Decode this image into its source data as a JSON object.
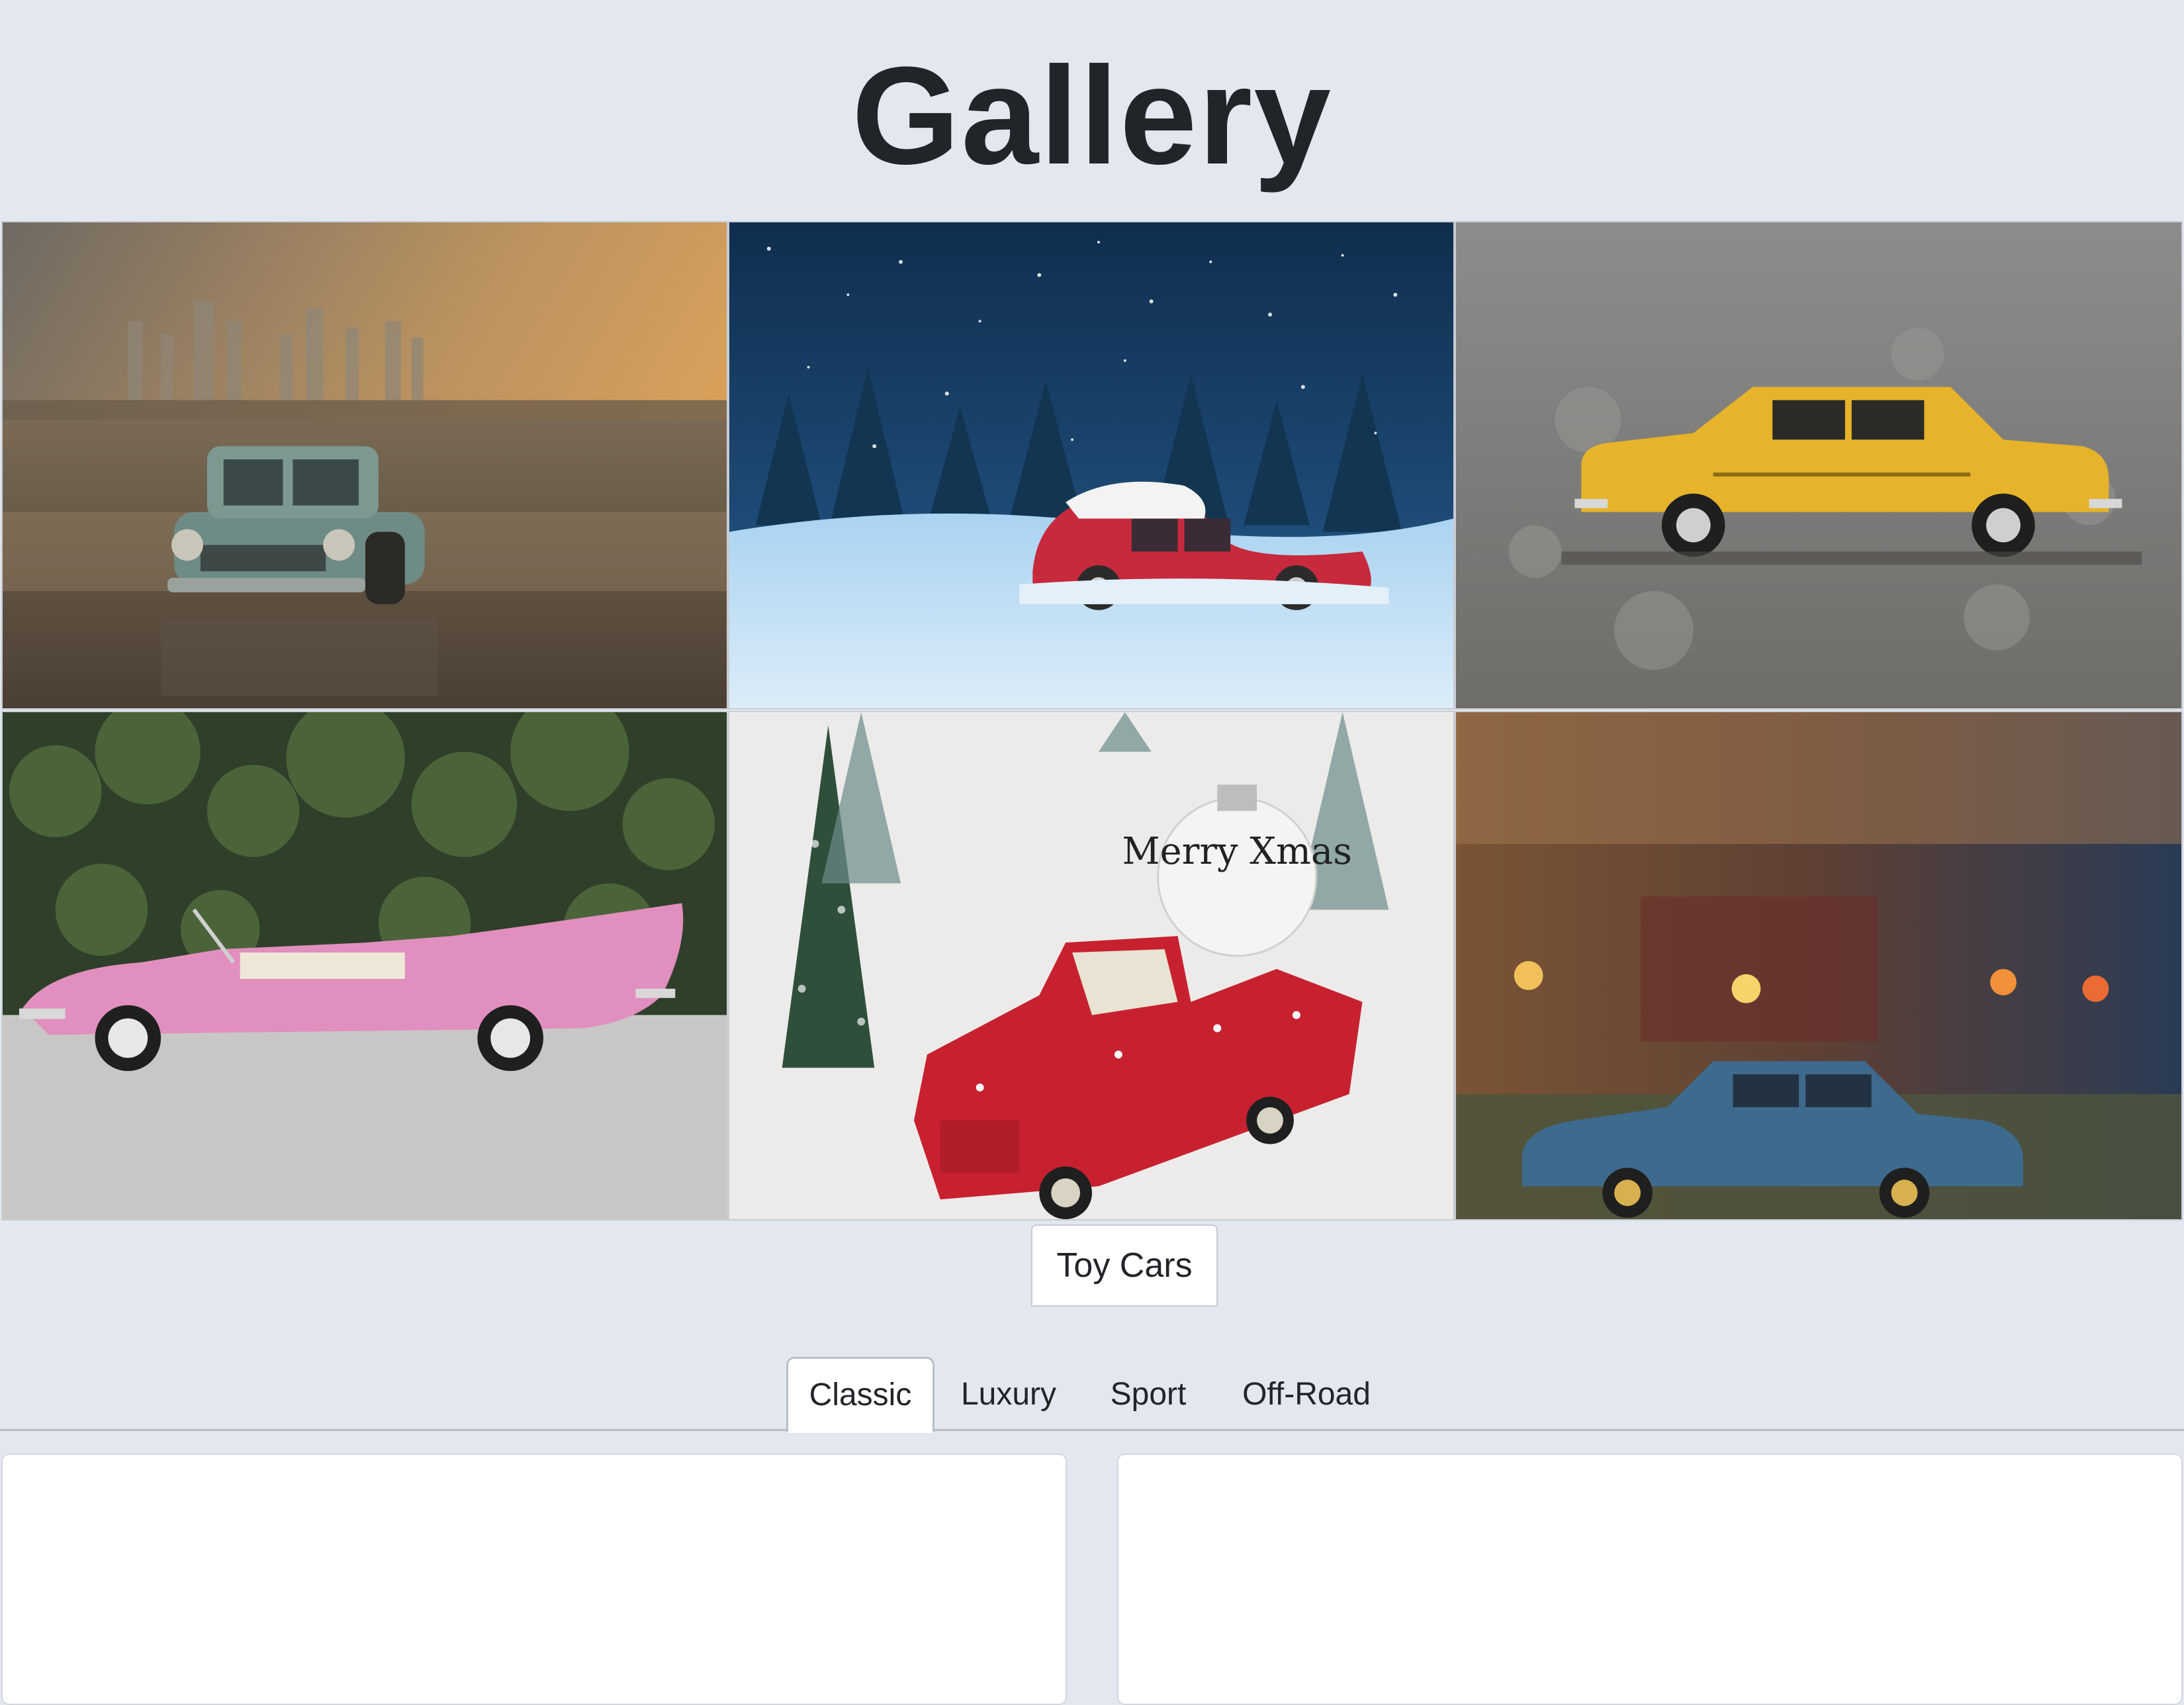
{
  "page": {
    "title": "Gallery"
  },
  "gallery": {
    "images": [
      {
        "name": "toy-car-beach-photo",
        "subject": "teal toy car on reflective beach at sunset"
      },
      {
        "name": "toy-car-snow-photo",
        "subject": "red beetle toy car in snowfall"
      },
      {
        "name": "toy-car-yellow-photo",
        "subject": "yellow sedan toy car on asphalt"
      },
      {
        "name": "toy-car-pink-photo",
        "subject": "pink convertible toy car"
      },
      {
        "name": "toy-car-xmas-photo",
        "subject": "red pickup toy car with ornament"
      },
      {
        "name": "toy-car-blue-photo",
        "subject": "blue sedan toy car with bokeh"
      }
    ],
    "caption_tab": "Toy Cars"
  },
  "tabs": {
    "items": [
      {
        "label": "Classic",
        "active": true
      },
      {
        "label": "Luxury",
        "active": false
      },
      {
        "label": "Sport",
        "active": false
      },
      {
        "label": "Off-Road",
        "active": false
      }
    ]
  },
  "ornament_text": "Merry Xmas"
}
